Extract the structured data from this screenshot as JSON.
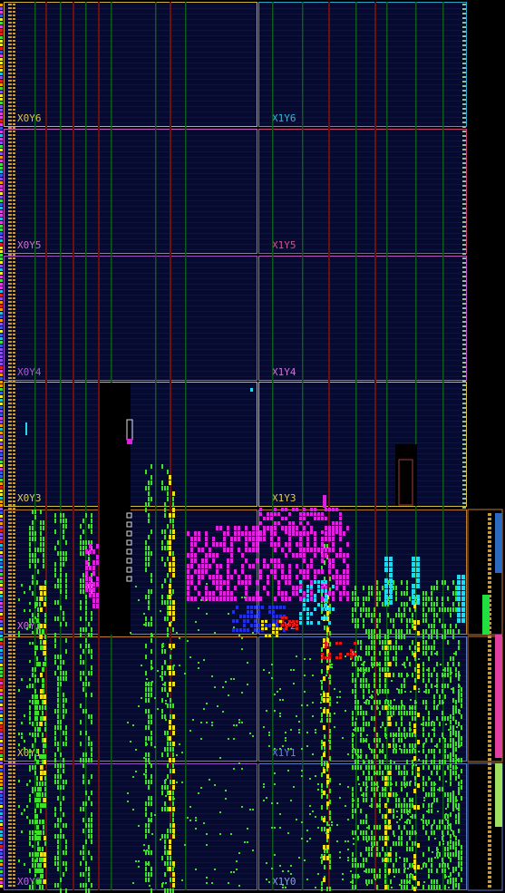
{
  "app": {
    "view": "device"
  },
  "clock_regions": [
    {
      "id": "X0Y6",
      "label": "X0Y6",
      "color": "#c9b23a",
      "label_color": "#e0c24a",
      "col": 0,
      "row": 6
    },
    {
      "id": "X1Y6",
      "label": "X1Y6",
      "color": "#2aa6c9",
      "label_color": "#33b8dd",
      "col": 1,
      "row": 6
    },
    {
      "id": "X0Y5",
      "label": "X0Y5",
      "color": "#c35cc3",
      "label_color": "#d070d0",
      "col": 0,
      "row": 5
    },
    {
      "id": "X1Y5",
      "label": "X1Y5",
      "color": "#c9407a",
      "label_color": "#d8508a",
      "col": 1,
      "row": 5
    },
    {
      "id": "X0Y4",
      "label": "X0Y4",
      "color": "#a04fd0",
      "label_color": "#a85ad8",
      "col": 0,
      "row": 4
    },
    {
      "id": "X1Y4",
      "label": "X1Y4",
      "color": "#c055c8",
      "label_color": "#d070e0",
      "col": 1,
      "row": 4
    },
    {
      "id": "X0Y3",
      "label": "X0Y3",
      "color": "#d0c040",
      "label_color": "#e0d050",
      "col": 0,
      "row": 3
    },
    {
      "id": "X1Y3",
      "label": "X1Y3",
      "color": "#d0c040",
      "label_color": "#e0d050",
      "col": 1,
      "row": 3
    },
    {
      "id": "X0Y2",
      "label": "X0Y2",
      "color": "#c07a30",
      "label_color": "#e06adf",
      "col": 0,
      "row": 2
    },
    {
      "id": "X1Y2",
      "label": "X1Y2",
      "color": "#c07a30",
      "label_color": "#d070e0",
      "col": 1,
      "row": 2
    },
    {
      "id": "X0Y1",
      "label": "X0Y1",
      "color": "#c07a30",
      "label_color": "#e0d050",
      "col": 0,
      "row": 1
    },
    {
      "id": "X1Y1",
      "label": "X1Y1",
      "color": "#5a78c8",
      "label_color": "#6a80e0",
      "col": 1,
      "row": 1
    },
    {
      "id": "X0Y0",
      "label": "X0Y0",
      "color": "#9050d0",
      "label_color": "#c060e0",
      "col": 0,
      "row": 0
    },
    {
      "id": "X1Y0",
      "label": "X1Y0",
      "color": "#5a78c8",
      "label_color": "#8aa0e0",
      "col": 1,
      "row": 0
    }
  ],
  "colors": {
    "background": "#000000",
    "region_fill": "#070a30",
    "dsp_column": "#6a1010",
    "bram_column": "#0e5a18",
    "grid_line": "#1b2a5a",
    "cell_green": "#3de02a",
    "cell_yellow": "#f0e020",
    "cell_magenta": "#e020e0",
    "cell_cyan": "#20d8f0",
    "cell_blue": "#2030e0",
    "cell_red": "#e01818",
    "cell_white": "#e8e8e8"
  },
  "placement_legend": [
    "green-cells",
    "yellow-cells",
    "magenta-cells",
    "cyan-cells",
    "blue-cells",
    "red-cells"
  ]
}
